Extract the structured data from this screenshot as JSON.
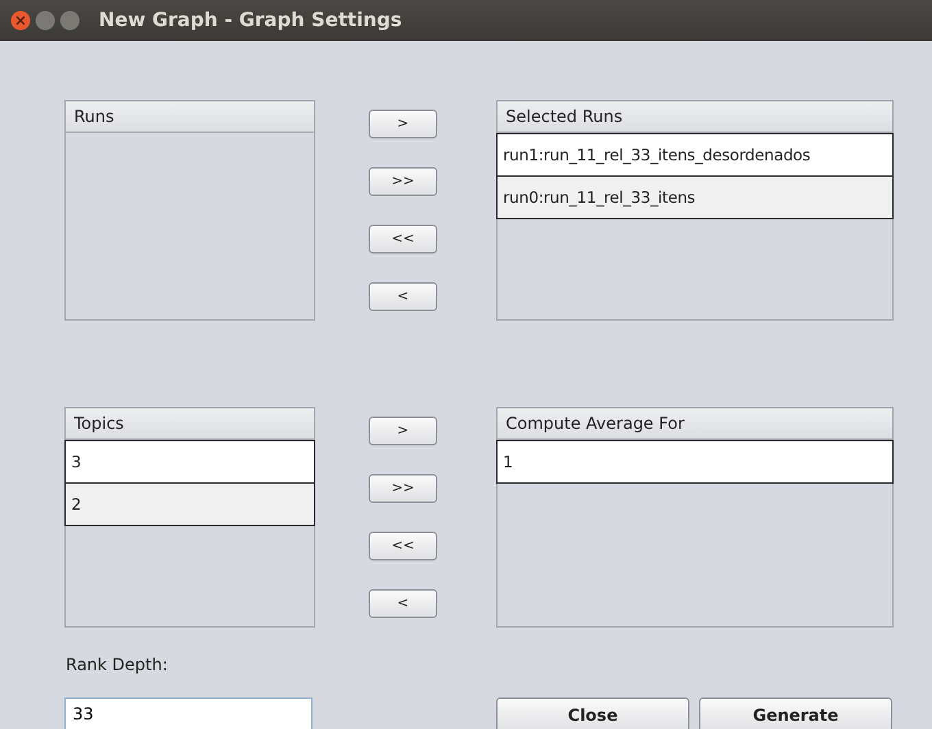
{
  "window": {
    "title": "New Graph - Graph Settings"
  },
  "sections": [
    {
      "source": {
        "header": "Runs"
      },
      "buttons": [
        ">",
        ">>",
        "<<",
        "<"
      ],
      "target": {
        "header": "Selected Runs",
        "items": [
          {
            "label": "run1:run_11_rel_33_itens_desordenados",
            "selected": true
          },
          {
            "label": "run0:run_11_rel_33_itens",
            "selected": false
          }
        ]
      }
    },
    {
      "source": {
        "header": "Topics",
        "items": [
          {
            "label": "3",
            "selected": true
          },
          {
            "label": "2",
            "selected": false
          }
        ]
      },
      "buttons": [
        ">",
        ">>",
        "<<",
        "<"
      ],
      "target": {
        "header": "Compute Average For",
        "items": [
          {
            "label": "1",
            "selected": true
          }
        ]
      }
    }
  ],
  "rank_depth": {
    "label": "Rank Depth:",
    "value": "33"
  },
  "buttons": [
    "Close",
    "Generate"
  ]
}
